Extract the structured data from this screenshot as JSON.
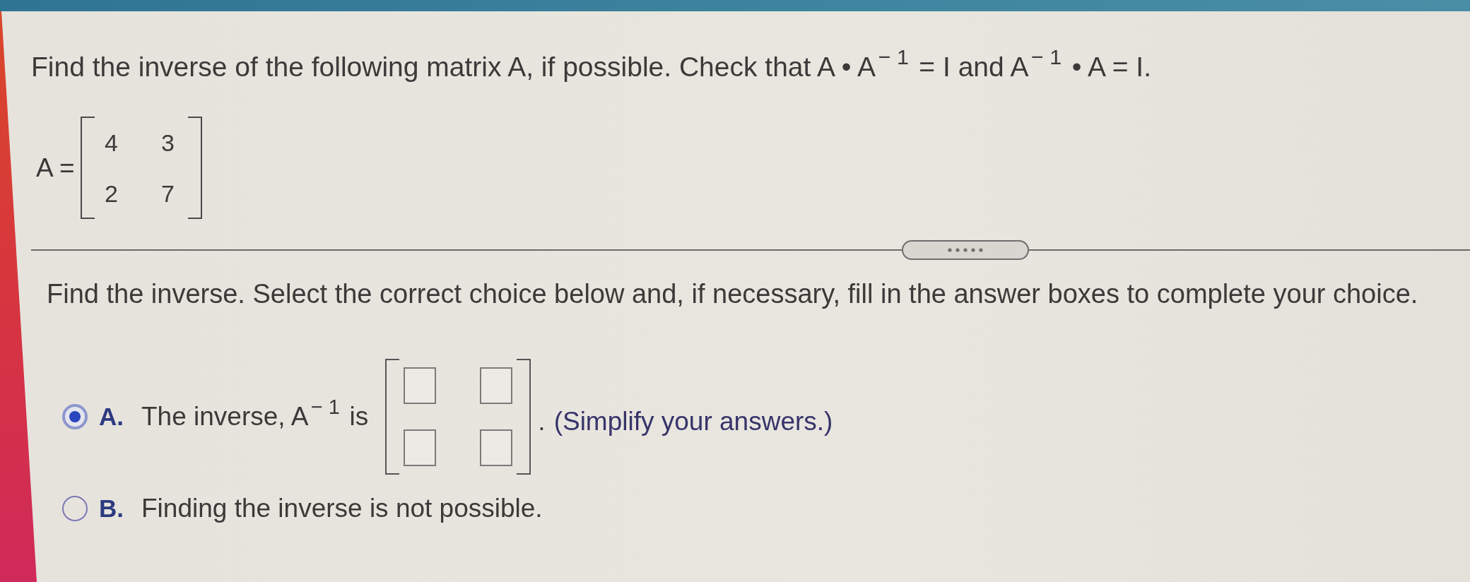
{
  "question": {
    "text": "Find the inverse of the following matrix A, if possible. Check that A • A$^{− 1}$ = I and A$^{− 1}$ • A = I."
  },
  "matrix": {
    "label": "A =",
    "rows": [
      [
        "4",
        "3"
      ],
      [
        "2",
        "7"
      ]
    ]
  },
  "instruction": {
    "text": "Find the inverse. Select the correct choice below and, if necessary, fill in the answer boxes to complete your choice."
  },
  "choices": [
    {
      "letter": "A.",
      "selected": true,
      "kind": "answer_matrix",
      "text": "The inverse, A$^{− 1}$ is",
      "suffix": ".",
      "note": "(Simplify your answers.)"
    },
    {
      "letter": "B.",
      "selected": false,
      "kind": "statement",
      "text": "Finding the inverse is not possible."
    }
  ]
}
